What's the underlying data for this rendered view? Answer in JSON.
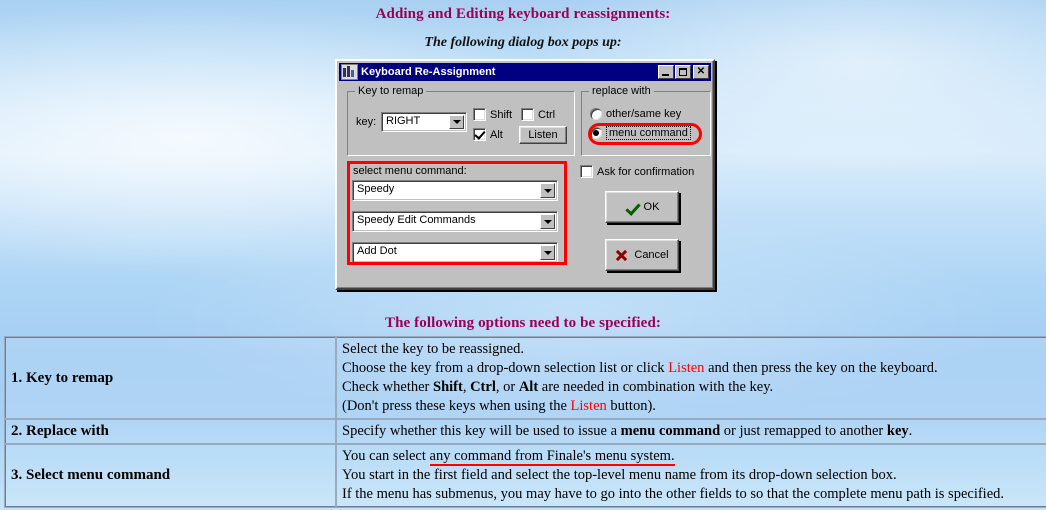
{
  "page": {
    "title_main": "Adding and Editing keyboard reassignments:",
    "subtitle": "The following dialog box pops up:",
    "options_heading": "The following options need to be specified:",
    "accent_color": "#9b0057",
    "red_annotation_color": "#fe0000"
  },
  "dialog": {
    "title": "Keyboard Re-Assignment",
    "icon": "keyboard-app-icon",
    "titlebar_buttons": {
      "minimize": "minimize-button",
      "maximize": "maximize-button",
      "close": "close-button"
    },
    "key_to_remap": {
      "group_label": "Key to remap",
      "key_label": "key:",
      "key_value": "RIGHT",
      "shift_label": "Shift",
      "shift_checked": false,
      "ctrl_label": "Ctrl",
      "ctrl_checked": false,
      "alt_label": "Alt",
      "alt_checked": true,
      "listen_label": "Listen"
    },
    "replace_with": {
      "group_label": "replace with",
      "option_other_key": "other/same key",
      "option_menu_command": "menu command",
      "selected": "menu command"
    },
    "select_menu_command": {
      "label": "select menu command:",
      "field1": "Speedy",
      "field2": "Speedy Edit Commands",
      "field3": "Add Dot"
    },
    "ask_for_confirmation": {
      "label": "Ask for confirmation",
      "checked": false
    },
    "buttons": {
      "ok": "OK",
      "cancel": "Cancel"
    }
  },
  "options_table": {
    "rows": [
      {
        "label": "1. Key to remap",
        "lines": [
          "Select the key to be reassigned.",
          "Choose the key from a drop-down selection list or click Listen and then press the key on the keyboard.",
          "Check whether Shift, Ctrl, or Alt are needed in combination with the key.",
          "(Don't press these keys when using the Listen button)."
        ]
      },
      {
        "label": "2. Replace with",
        "lines": [
          "Specify whether this key will be used to issue a menu command or just remapped to another key."
        ]
      },
      {
        "label": "3. Select menu command",
        "lines": [
          "You can select any command from Finale's menu system.",
          "You start in the first field and select the top-level menu name from its drop-down selection box.",
          "If the menu has submenus, you may have to go into the other fields to so that the complete menu path is specified."
        ]
      }
    ],
    "row1_line2_parts": {
      "a": "Choose the key from a drop-down selection list or click ",
      "listen": "Listen",
      "b": " and then press the key on the keyboard."
    },
    "row1_line3_parts": {
      "a": "Check whether ",
      "shift": "Shift",
      "sep1": ", ",
      "ctrl": "Ctrl",
      "sep2": ", or ",
      "alt": "Alt",
      "b": " are needed in combination with the key."
    },
    "row1_line4_parts": {
      "a": "(Don't press these keys when using the ",
      "listen": "Listen",
      "b": " button)."
    },
    "row2_line1_parts": {
      "a": "Specify whether this key will be used to issue a ",
      "menucmd": "menu command",
      "b": " or just remapped to another ",
      "key": "key",
      "c": "."
    },
    "row3_line1_parts": {
      "a": "You can select ",
      "underlined": "any command from Finale's menu system."
    }
  }
}
